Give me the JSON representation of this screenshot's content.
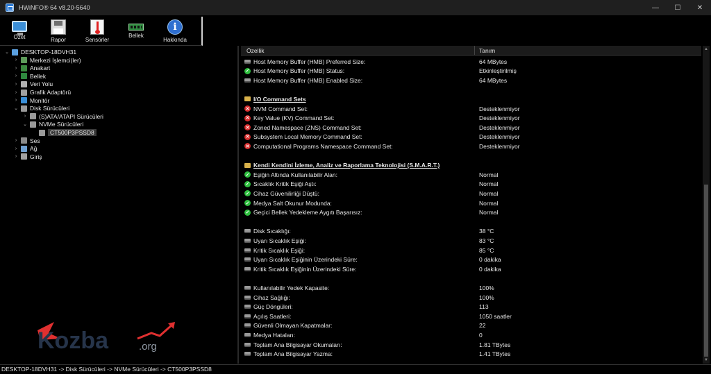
{
  "window": {
    "title": "HWiNFO® 64 v8.20-5640",
    "minimize": "—",
    "maximize": "☐",
    "close": "✕"
  },
  "toolbar": [
    {
      "label": "Özet",
      "icon": "monitor-icon"
    },
    {
      "label": "Rapor",
      "icon": "floppy-icon"
    },
    {
      "label": "Sensörler",
      "icon": "thermometer-icon"
    },
    {
      "label": "Bellek",
      "icon": "ram-icon"
    },
    {
      "label": "Hakkında",
      "icon": "info-icon"
    }
  ],
  "tree": [
    {
      "label": "DESKTOP-18DVH31",
      "level": 0,
      "expander": "v",
      "icon": "computer-icon",
      "color": "#5aa0e0"
    },
    {
      "label": "Merkezi İşlemci(ler)",
      "level": 1,
      "expander": ">",
      "icon": "cpu-icon",
      "color": "#5e9c5a"
    },
    {
      "label": "Anakart",
      "level": 1,
      "expander": ">",
      "icon": "motherboard-icon",
      "color": "#3b8a3f"
    },
    {
      "label": "Bellek",
      "level": 1,
      "expander": ">",
      "icon": "memory-icon",
      "color": "#2f8a3f"
    },
    {
      "label": "Veri Yolu",
      "level": 1,
      "expander": ">",
      "icon": "bus-icon",
      "color": "#b0b0b0"
    },
    {
      "label": "Grafik Adaptörü",
      "level": 1,
      "expander": ">",
      "icon": "gpu-icon",
      "color": "#a0a0a0"
    },
    {
      "label": "Monitör",
      "level": 1,
      "expander": ">",
      "icon": "monitor-icon",
      "color": "#3a8fd8"
    },
    {
      "label": "Disk Sürücüleri",
      "level": 1,
      "expander": "v",
      "icon": "disk-icon",
      "color": "#9a9a9a"
    },
    {
      "label": "(S)ATA/ATAPI Sürücüleri",
      "level": 2,
      "expander": ">",
      "icon": "drive-icon",
      "color": "#9a9a9a"
    },
    {
      "label": "NVMe Sürücüleri",
      "level": 2,
      "expander": "v",
      "icon": "drive-icon",
      "color": "#9a9a9a"
    },
    {
      "label": "CT500P3PSSD8",
      "level": 3,
      "expander": "",
      "icon": "drive-icon",
      "color": "#9a9a9a",
      "selected": true
    },
    {
      "label": "Ses",
      "level": 1,
      "expander": ">",
      "icon": "audio-icon",
      "color": "#8a8a8a"
    },
    {
      "label": "Ağ",
      "level": 1,
      "expander": ">",
      "icon": "network-icon",
      "color": "#6f9fd0"
    },
    {
      "label": "Giriş",
      "level": 1,
      "expander": ">",
      "icon": "input-icon",
      "color": "#a0a0a0"
    }
  ],
  "list": {
    "columns": {
      "property": "Özellik",
      "value": "Tanım"
    },
    "rows": [
      {
        "icon": "drive",
        "property": "Host Memory Buffer (HMB) Preferred Size:",
        "value": "64 MBytes"
      },
      {
        "icon": "ok",
        "property": "Host Memory Buffer (HMB) Status:",
        "value": "Etkinleştirilmiş"
      },
      {
        "icon": "drive",
        "property": "Host Memory Buffer (HMB) Enabled Size:",
        "value": "64 MBytes"
      },
      {
        "icon": "",
        "property": "",
        "value": ""
      },
      {
        "icon": "folder",
        "property": "I/O Command Sets",
        "value": "",
        "section": true
      },
      {
        "icon": "no",
        "property": "NVM Command Set:",
        "value": "Desteklenmiyor"
      },
      {
        "icon": "no",
        "property": "Key Value (KV) Command Set:",
        "value": "Desteklenmiyor"
      },
      {
        "icon": "no",
        "property": "Zoned Namespace (ZNS) Command Set:",
        "value": "Desteklenmiyor"
      },
      {
        "icon": "no",
        "property": "Subsystem Local Memory Command Set:",
        "value": "Desteklenmiyor"
      },
      {
        "icon": "no",
        "property": "Computational Programs Namespace Command Set:",
        "value": "Desteklenmiyor"
      },
      {
        "icon": "",
        "property": "",
        "value": ""
      },
      {
        "icon": "folder",
        "property": "Kendi Kendini İzleme, Analiz ve Raporlama Teknolojisi (S.M.A.R.T.)",
        "value": "",
        "section": true
      },
      {
        "icon": "ok",
        "property": "Eşiğin Altında Kullanılabilir Alan:",
        "value": "Normal"
      },
      {
        "icon": "ok",
        "property": "Sıcaklık Kritik Eşiği Aştı:",
        "value": "Normal"
      },
      {
        "icon": "ok",
        "property": "Cihaz Güvenilirliği Düştü:",
        "value": "Normal"
      },
      {
        "icon": "ok",
        "property": "Medya Salt Okunur Modunda:",
        "value": "Normal"
      },
      {
        "icon": "ok",
        "property": "Geçici Bellek Yedekleme Aygıtı Başarısız:",
        "value": "Normal"
      },
      {
        "icon": "",
        "property": "",
        "value": ""
      },
      {
        "icon": "drive",
        "property": "Disk Sıcaklığı:",
        "value": "38 °C"
      },
      {
        "icon": "drive",
        "property": "Uyarı Sıcaklık Eşiği:",
        "value": "83 °C"
      },
      {
        "icon": "drive",
        "property": "Kritik Sıcaklık Eşiği:",
        "value": "85 °C"
      },
      {
        "icon": "drive",
        "property": "Uyarı Sıcaklık Eşiğinin Üzerindeki Süre:",
        "value": "0 dakika"
      },
      {
        "icon": "drive",
        "property": "Kritik Sıcaklık Eşiğinin Üzerindeki Süre:",
        "value": "0 dakika"
      },
      {
        "icon": "",
        "property": "",
        "value": ""
      },
      {
        "icon": "drive",
        "property": "Kullanılabilir Yedek Kapasite:",
        "value": "100%"
      },
      {
        "icon": "drive",
        "property": "Cihaz Sağlığı:",
        "value": "100%"
      },
      {
        "icon": "drive",
        "property": "Güç Döngüleri:",
        "value": "113"
      },
      {
        "icon": "drive",
        "property": "Açılış Saatleri:",
        "value": "1050 saatler"
      },
      {
        "icon": "drive",
        "property": "Güvenli Olmayan Kapatmalar:",
        "value": "22"
      },
      {
        "icon": "drive",
        "property": "Medya Hataları:",
        "value": "0"
      },
      {
        "icon": "drive",
        "property": "Toplam Ana Bilgisayar Okumaları:",
        "value": "1.81 TBytes"
      },
      {
        "icon": "drive",
        "property": "Toplam Ana Bilgisayar Yazma:",
        "value": "1.41 TBytes"
      }
    ]
  },
  "watermark": {
    "text": "Kozba",
    "suffix": ".org",
    "colors": {
      "red": "#e03030",
      "dark": "#26344a",
      "grey": "#8f98a3"
    }
  },
  "statusbar": {
    "path": "DESKTOP-18DVH31 -> Disk Sürücüleri -> NVMe Sürücüleri -> CT500P3PSSD8"
  }
}
